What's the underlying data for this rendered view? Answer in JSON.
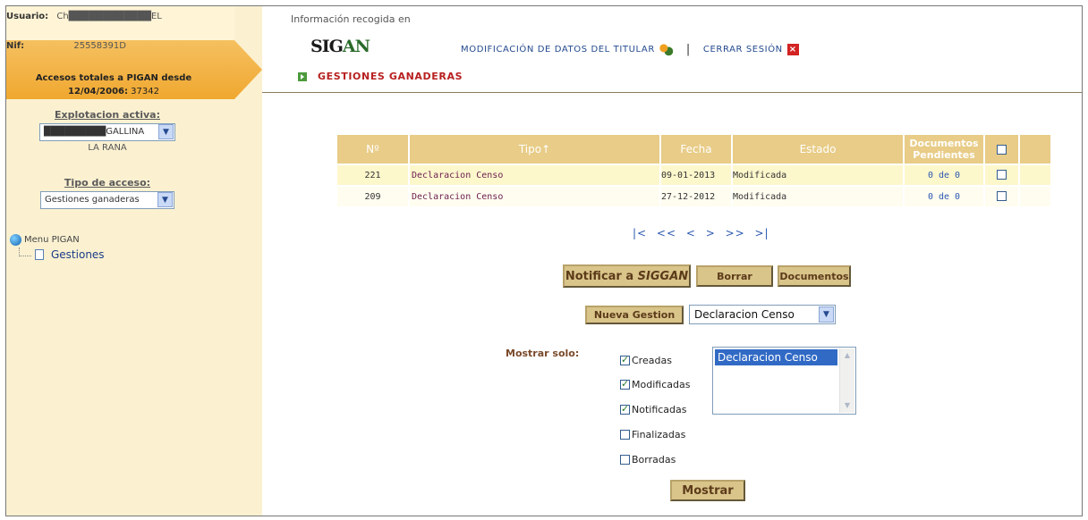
{
  "sidebar": {
    "usuario_label": "Usuario:",
    "usuario_value": "Ch████████████EL",
    "nif_label": "Nif:",
    "nif_value": "25558391D",
    "accesos_text": "Accesos totales a PIGAN desde",
    "accesos_date": "12/04/2006:",
    "accesos_count": "37342",
    "explotacion_label": "Explotacion activa:",
    "explotacion_value": "█████████GALLINA",
    "explotacion_sub": "LA RANA",
    "tipo_acceso_label": "Tipo de acceso:",
    "tipo_acceso_value": "Gestiones ganaderas",
    "menu_root": "Menu PIGAN",
    "menu_child": "Gestiones"
  },
  "header": {
    "info": "Información recogida en",
    "logo_a": "SIG",
    "logo_b": "AN",
    "nav_modificacion": "MODIFICACIÓN DE DATOS DEL TITULAR",
    "nav_sep": "|",
    "nav_cerrar": "CERRAR SESIÓN",
    "gestiones_title": "GESTIONES GANADERAS"
  },
  "table": {
    "headers": [
      "Nº",
      "Tipo↑",
      "Fecha",
      "Estado",
      "Documentos Pendientes"
    ],
    "rows": [
      {
        "n": "221",
        "tipo": "Declaracion Censo",
        "fecha": "09-01-2013",
        "estado": "Modificada",
        "docs": "0 de 0"
      },
      {
        "n": "209",
        "tipo": "Declaracion Censo",
        "fecha": "27-12-2012",
        "estado": "Modificada",
        "docs": "0 de 0"
      }
    ]
  },
  "pager": "|<  <<  <  >  >>  >|",
  "buttons": {
    "notificar": "Notificar a",
    "notificar_em": "SIGGAN",
    "borrar": "Borrar",
    "documentos": "Documentos",
    "nueva": "Nueva Gestion",
    "mostrar": "Mostrar"
  },
  "nueva_select": "Declaracion Censo",
  "filter": {
    "label": "Mostrar solo:",
    "checks": [
      {
        "label": "Creadas",
        "checked": true
      },
      {
        "label": "Modificadas",
        "checked": true
      },
      {
        "label": "Notificadas",
        "checked": true
      },
      {
        "label": "Finalizadas",
        "checked": false
      },
      {
        "label": "Borradas",
        "checked": false
      }
    ],
    "list_option": "Declaracion Censo"
  },
  "colors": {
    "accent": "#f0a830",
    "header_gold": "#e8cc87",
    "sidebar_bg": "#fbf1d1",
    "link_blue": "#244a8e",
    "title_red": "#b82020"
  }
}
